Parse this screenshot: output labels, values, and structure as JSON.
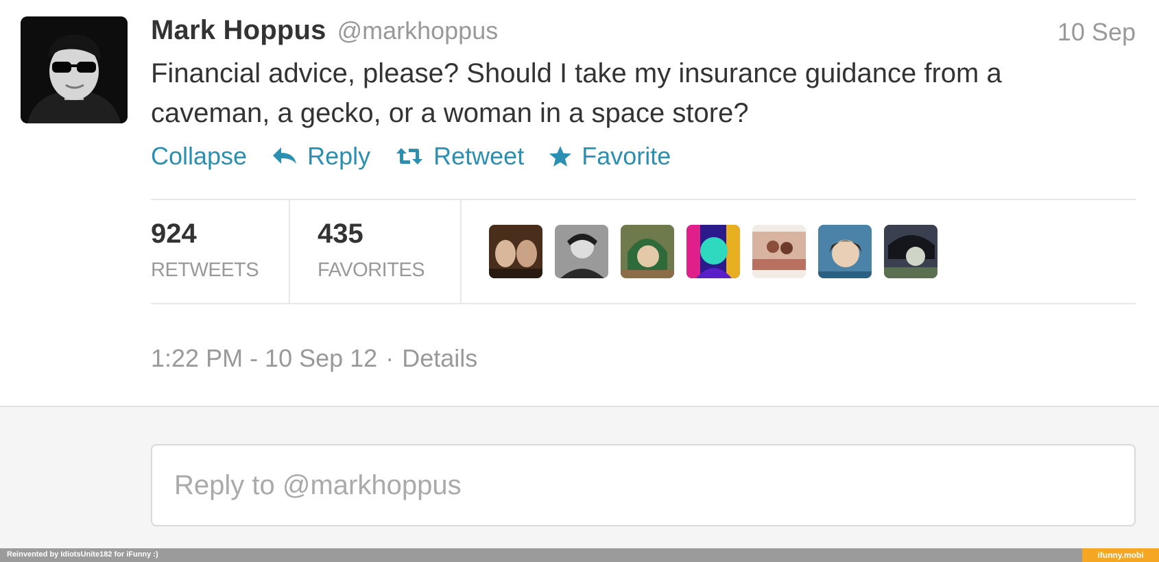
{
  "tweet": {
    "fullname": "Mark Hoppus",
    "username": "@markhoppus",
    "time_short": "10 Sep",
    "text": "Financial advice, please? Should I take my insurance guidance from a caveman, a gecko, or a woman in a space store?",
    "actions": {
      "collapse": "Collapse",
      "reply": "Reply",
      "retweet": "Retweet",
      "favorite": "Favorite"
    },
    "stats": {
      "retweets_count": "924",
      "retweets_label": "RETWEETS",
      "favorites_count": "435",
      "favorites_label": "FAVORITES"
    },
    "timestamp": "1:22 PM - 10 Sep 12",
    "separator": "·",
    "details": "Details"
  },
  "reply": {
    "placeholder": "Reply to @markhoppus"
  },
  "footer": {
    "credit": "Reinvented by IdiotsUnite182 for iFunny :)",
    "brand": "ifunny.mobi"
  },
  "colors": {
    "link": "#2a8fb0",
    "muted": "#999999",
    "text": "#333333",
    "brand": "#f5a623"
  },
  "icons": [
    "reply-arrow-icon",
    "retweet-icon",
    "star-icon"
  ]
}
